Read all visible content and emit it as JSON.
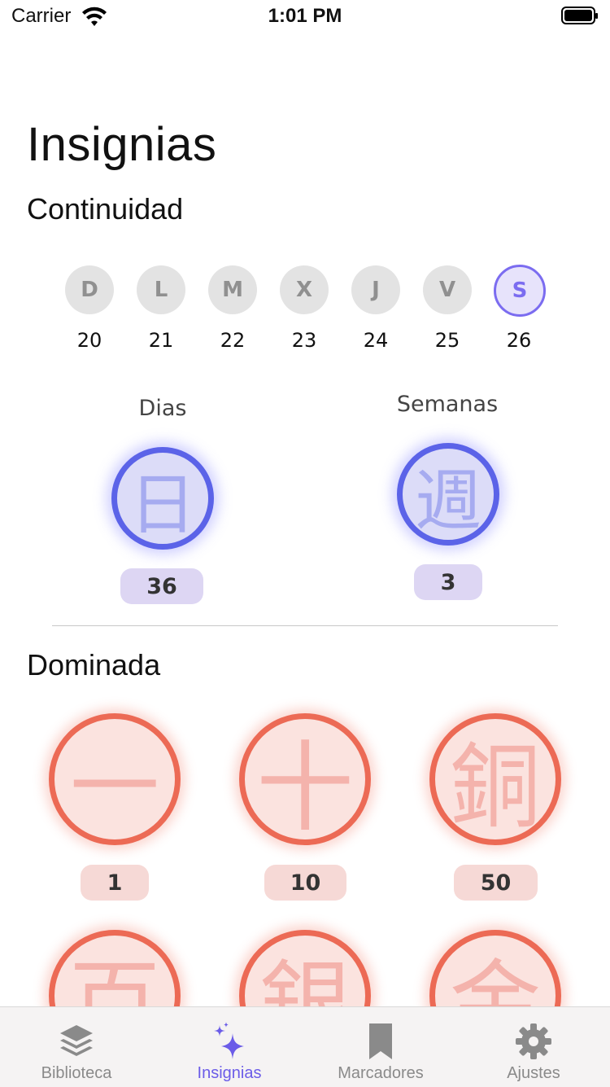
{
  "status": {
    "carrier": "Carrier",
    "time": "1:01 PM"
  },
  "page": {
    "title": "Insignias"
  },
  "continuity": {
    "heading": "Continuidad",
    "days": [
      {
        "letter": "D",
        "num": "20",
        "active": false
      },
      {
        "letter": "L",
        "num": "21",
        "active": false
      },
      {
        "letter": "M",
        "num": "22",
        "active": false
      },
      {
        "letter": "X",
        "num": "23",
        "active": false
      },
      {
        "letter": "J",
        "num": "24",
        "active": false
      },
      {
        "letter": "V",
        "num": "25",
        "active": false
      },
      {
        "letter": "S",
        "num": "26",
        "active": true
      }
    ],
    "streaks": [
      {
        "label": "Dias",
        "glyph": "日",
        "count": "36"
      },
      {
        "label": "Semanas",
        "glyph": "週",
        "count": "3"
      }
    ]
  },
  "mastered": {
    "heading": "Dominada",
    "badges": [
      {
        "glyph": "一",
        "count": "1"
      },
      {
        "glyph": "十",
        "count": "10"
      },
      {
        "glyph": "銅",
        "count": "50"
      },
      {
        "glyph": "百",
        "count": ""
      },
      {
        "glyph": "銀",
        "count": ""
      },
      {
        "glyph": "金",
        "count": ""
      }
    ]
  },
  "tabs": [
    {
      "label": "Biblioteca",
      "icon": "stack-icon",
      "active": false
    },
    {
      "label": "Insignias",
      "icon": "sparkles-icon",
      "active": true
    },
    {
      "label": "Marcadores",
      "icon": "bookmark-icon",
      "active": false
    },
    {
      "label": "Ajustes",
      "icon": "gear-icon",
      "active": false
    }
  ],
  "colors": {
    "accent": "#6b5ce8",
    "streak_ring": "#5b63e8",
    "mastery_ring": "#ec6a55"
  }
}
